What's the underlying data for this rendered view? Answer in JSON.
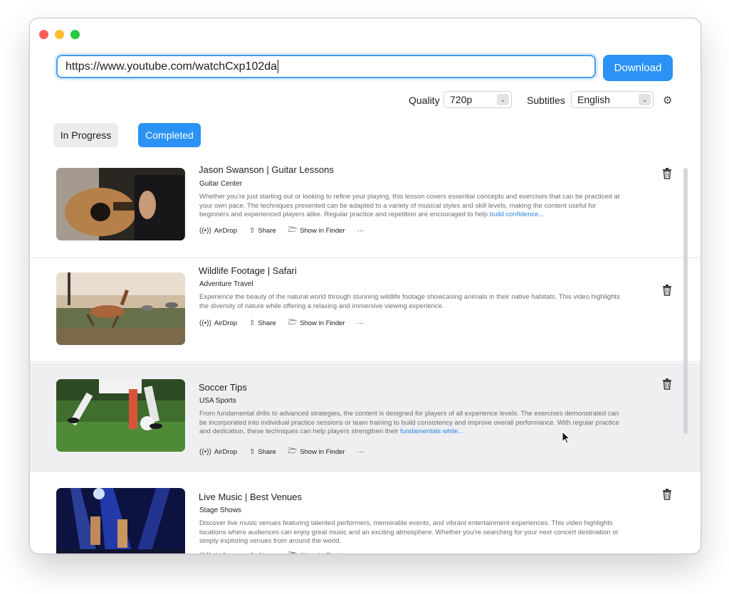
{
  "toolbar": {
    "url_value": "https://www.youtube.com/watchCxp102da",
    "download_label": "Download",
    "quality_label": "Quality",
    "quality_value": "720p",
    "subtitles_label": "Subtitles",
    "subtitles_value": "English"
  },
  "tabs": {
    "in_progress": "In Progress",
    "completed": "Completed"
  },
  "actions": {
    "airdrop": "AirDrop",
    "share": "Share",
    "show_in_finder": "Show in Finder",
    "more": "···"
  },
  "items": [
    {
      "title": "Jason Swanson | Guitar Lessons",
      "channel": "Guitar Center",
      "description": "Whether you’re just starting out or looking to refine your playing, this lesson covers essential concepts and exercises that can be practiced at your own pace. The techniques presented can be adapted to a variety of musical styles and skill levels, making the content useful for beginners and experienced players alike. Regular practice and repetition are encouraged to help ",
      "more": "build confidence..."
    },
    {
      "title": "Wildlife Footage | Safari",
      "channel": "Adventure Travel",
      "description": "Experience the beauty of the natural world through stunning wildlife footage showcasing animals in their native habitats. This video highlights the diversity of nature while offering a relaxing and immersive viewing experience.",
      "more": ""
    },
    {
      "title": "Soccer Tips",
      "channel": "USA Sports",
      "description": "From fundamental drills to advanced strategies, the content is designed for players of all experience levels. The exercises demonstrated can be incorporated into individual practice sessions or team training to build consistency and improve overall performance. With regular practice and dedication, these techniques can help players strengthen their ",
      "more": "fundamentals while..."
    },
    {
      "title": "Live Music | Best Venues",
      "channel": "Stage Shows",
      "description": "Discover live music venues featuring talented performers, memorable events, and vibrant entertainment experiences. This video highlights locations where audiences can enjoy great music and an exciting atmosphere. Whether you’re searching for your next concert destination or simply exploring venues from around the world.",
      "more": ""
    }
  ],
  "colors": {
    "accent": "#2a93f5",
    "link": "#2a86e6",
    "selected_row": "#efeff1"
  },
  "icons": [
    "airdrop-icon",
    "share-icon",
    "folder-icon",
    "more-icon",
    "trash-icon",
    "gear-icon",
    "chevron-down-icon"
  ]
}
